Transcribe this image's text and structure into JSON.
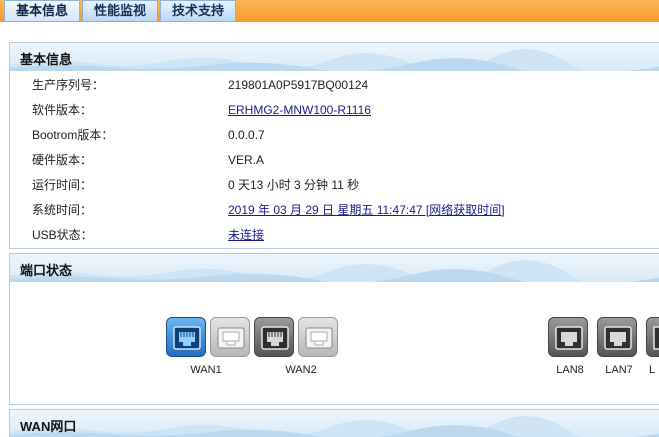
{
  "tabs": [
    {
      "label": "基本信息",
      "active": true
    },
    {
      "label": "性能监视",
      "active": false
    },
    {
      "label": "技术支持",
      "active": false
    }
  ],
  "basic_info": {
    "title": "基本信息",
    "rows": [
      {
        "label": "生产序列号：",
        "value": "219801A0P5917BQ00124",
        "link": false
      },
      {
        "label": "软件版本：",
        "value": "ERHMG2-MNW100-R1116",
        "link": true
      },
      {
        "label": "Bootrom版本：",
        "value": "0.0.0.7",
        "link": false
      },
      {
        "label": "硬件版本：",
        "value": "VER.A",
        "link": false
      },
      {
        "label": "运行时间：",
        "value": "0 天13 小时 3 分钟 11 秒",
        "link": false
      },
      {
        "label": "系统时间：",
        "value": "2019 年 03 月 29 日 星期五 11:47:47 [网络获取时间]",
        "link": true
      },
      {
        "label": "USB状态：",
        "value": "未连接",
        "link": true
      }
    ]
  },
  "port_status": {
    "title": "端口状态",
    "ports": [
      {
        "label": "WAN1",
        "state": "active"
      },
      {
        "label": "",
        "state": "idle"
      },
      {
        "label": "",
        "state": "connected"
      },
      {
        "label": "WAN2",
        "state": "idle"
      },
      {
        "label": "LAN8",
        "state": "connected"
      },
      {
        "label": "LAN7",
        "state": "connected"
      },
      {
        "label": "L",
        "state": "connected"
      }
    ]
  },
  "wan_port": {
    "title": "WAN网口"
  },
  "colors": {
    "tabbar": "#f79a2a",
    "tab_text": "#1a2f57",
    "link": "#1b1b8e",
    "section_border": "#b4cbe0"
  }
}
